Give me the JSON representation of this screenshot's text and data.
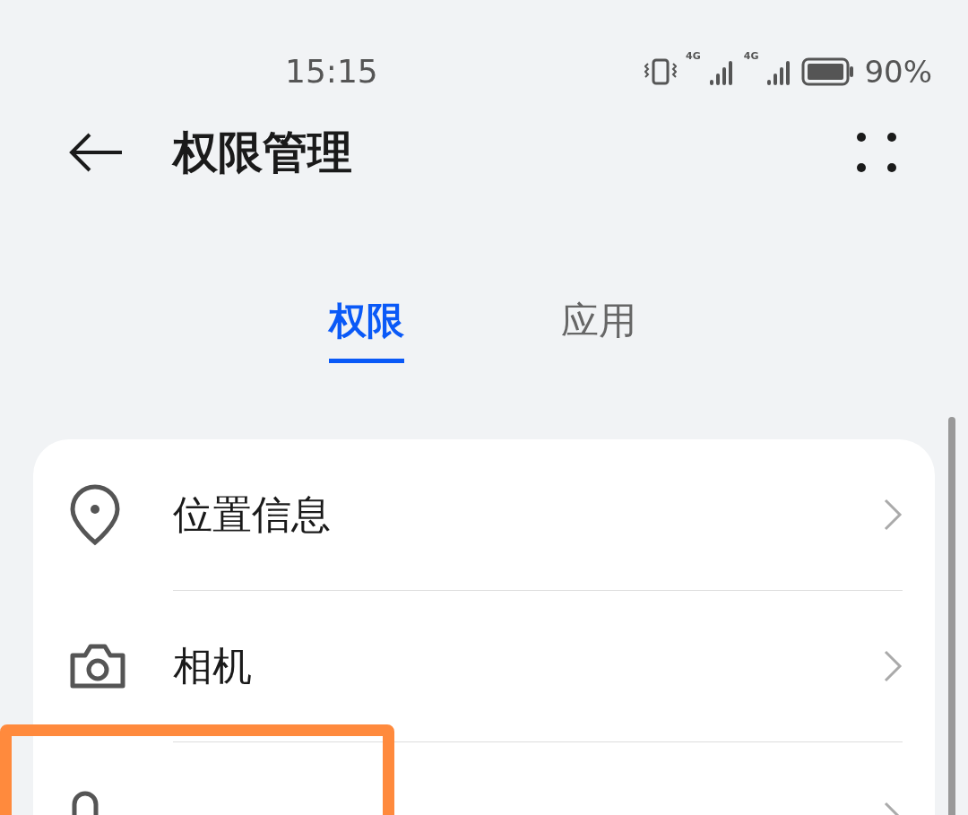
{
  "status_bar": {
    "time": "15:15",
    "signals": [
      {
        "network": "4G"
      },
      {
        "network": "4G"
      }
    ],
    "battery": "90%"
  },
  "header": {
    "title": "权限管理"
  },
  "tabs": [
    {
      "label": "权限",
      "selected": true
    },
    {
      "label": "应用",
      "selected": false
    }
  ],
  "permissions": [
    {
      "kind": "location",
      "label": "位置信息",
      "highlighted": false
    },
    {
      "kind": "camera",
      "label": "相机",
      "highlighted": false
    },
    {
      "kind": "microphone",
      "highlighted": true
    }
  ]
}
